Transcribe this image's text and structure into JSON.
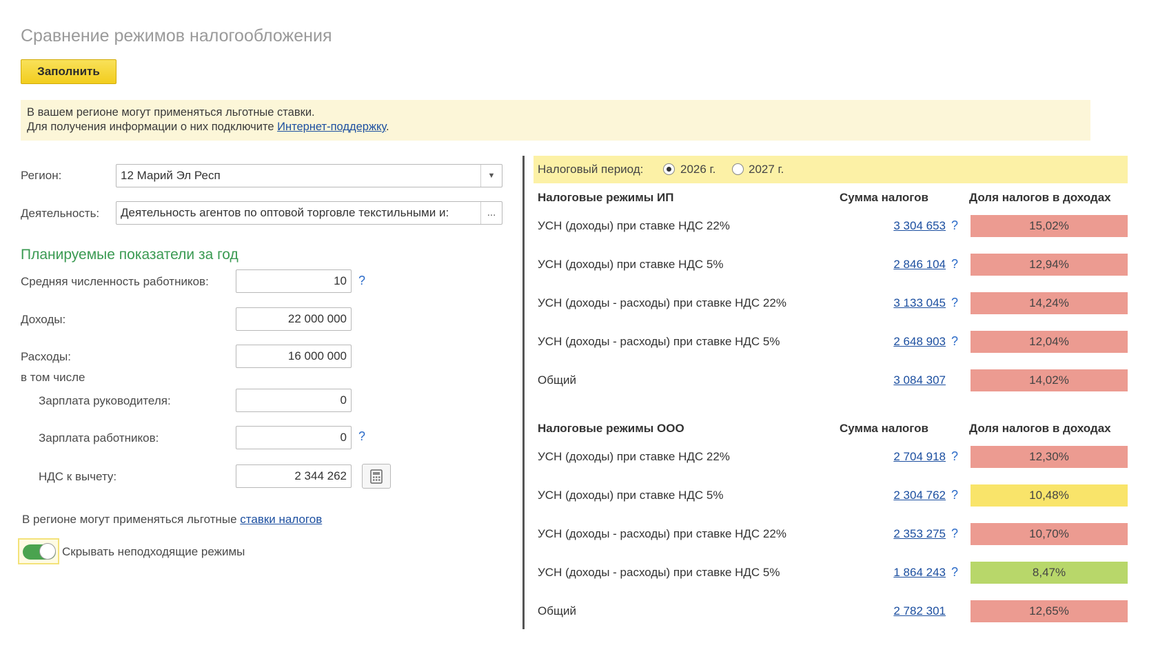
{
  "page": {
    "title": "Сравнение режимов налогообложения",
    "fill_button": "Заполнить"
  },
  "notice": {
    "line1": "В вашем регионе могут применяться льготные ставки.",
    "line2_prefix": "Для получения информации о них подключите ",
    "line2_link": "Интернет-поддержку",
    "line2_suffix": "."
  },
  "form": {
    "region_label": "Регион:",
    "region_value": "12 Марий Эл Респ",
    "activity_label": "Деятельность:",
    "activity_value": "Деятельность агентов по оптовой торговле текстильными и:",
    "activity_button": "...",
    "section_title": "Планируемые показатели за год",
    "employees_label": "Средняя численность работников:",
    "employees_value": "10",
    "income_label": "Доходы:",
    "income_value": "22 000 000",
    "expenses_label": "Расходы:",
    "including_label": "в том числе",
    "expenses_value": "16 000 000",
    "director_salary_label": "Зарплата руководителя:",
    "director_salary_value": "0",
    "workers_salary_label": "Зарплата работников:",
    "workers_salary_value": "0",
    "vat_deduction_label": "НДС к вычету:",
    "vat_deduction_value": "2 344 262",
    "help_mark": "?",
    "rates_text": "В регионе могут применяться льготные ",
    "rates_link": "ставки налогов",
    "toggle_label": "Скрывать неподходящие режимы",
    "toggle_on": true
  },
  "period": {
    "label": "Налоговый период:",
    "options": [
      "2026 г.",
      "2027 г."
    ],
    "selected": "2026 г."
  },
  "ip": {
    "header": "Налоговые режимы ИП",
    "sum_header": "Сумма налогов",
    "share_header": "Доля налогов в доходах",
    "rows": [
      {
        "name": "УСН (доходы) при ставке НДС 22%",
        "amount": "3 304 653",
        "help": "?",
        "share": "15,02%",
        "color": "#ec9b91"
      },
      {
        "name": "УСН (доходы) при ставке НДС 5%",
        "amount": "2 846 104",
        "help": "?",
        "share": "12,94%",
        "color": "#ec9b91"
      },
      {
        "name": "УСН (доходы - расходы) при ставке НДС 22%",
        "amount": "3 133 045",
        "help": "?",
        "share": "14,24%",
        "color": "#ec9b91"
      },
      {
        "name": "УСН (доходы - расходы) при ставке НДС 5%",
        "amount": "2 648 903",
        "help": "?",
        "share": "12,04%",
        "color": "#ec9b91"
      },
      {
        "name": "Общий",
        "amount": "3 084 307",
        "help": "",
        "share": "14,02%",
        "color": "#ec9b91"
      }
    ]
  },
  "ooo": {
    "header": "Налоговые режимы ООО",
    "sum_header": "Сумма налогов",
    "share_header": "Доля налогов в доходах",
    "rows": [
      {
        "name": "УСН (доходы) при ставке НДС 22%",
        "amount": "2 704 918",
        "help": "?",
        "share": "12,30%",
        "color": "#ec9b91"
      },
      {
        "name": "УСН (доходы) при ставке НДС 5%",
        "amount": "2 304 762",
        "help": "?",
        "share": "10,48%",
        "color": "#f9e46a"
      },
      {
        "name": "УСН (доходы - расходы) при ставке НДС 22%",
        "amount": "2 353 275",
        "help": "?",
        "share": "10,70%",
        "color": "#ec9b91"
      },
      {
        "name": "УСН (доходы - расходы) при ставке НДС 5%",
        "amount": "1 864 243",
        "help": "?",
        "share": "8,47%",
        "color": "#b8d76a"
      },
      {
        "name": "Общий",
        "amount": "2 782 301",
        "help": "",
        "share": "12,65%",
        "color": "#ec9b91"
      }
    ]
  }
}
